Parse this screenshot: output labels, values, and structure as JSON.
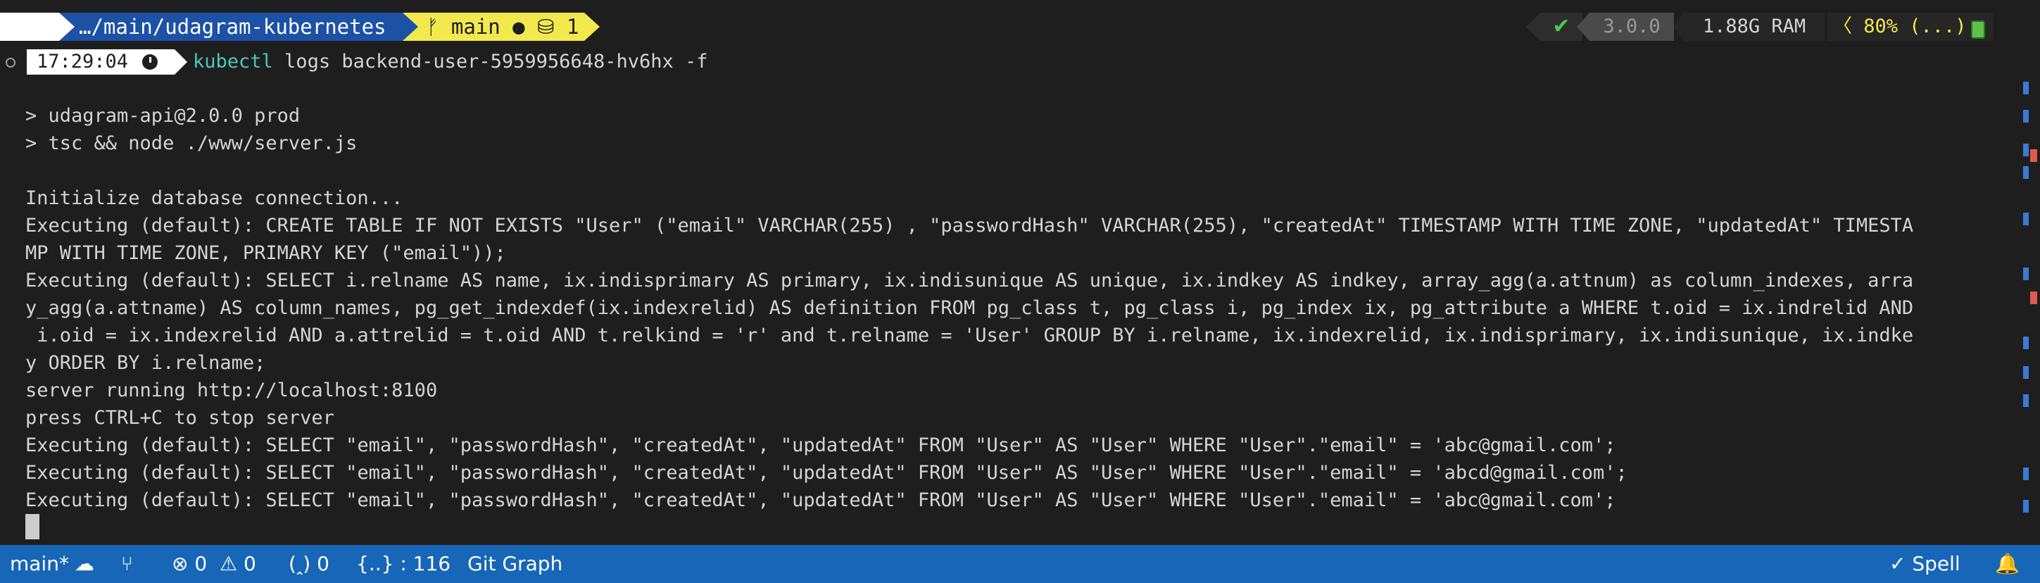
{
  "prompt": {
    "apple_glyph": "",
    "path": "…/main/udagram-kubernetes",
    "branch": "ᚠ main ● ⛁ 1",
    "check": "✔",
    "version": "3.0.0",
    "ram": "1.88G RAM",
    "battery": "80% (...)"
  },
  "row2": {
    "time": "17:29:04",
    "cmd_kw": "kubectl",
    "cmd_rest": " logs backend-user-5959956648-hv6hx -f"
  },
  "output": {
    "lines": [
      "> udagram-api@2.0.0 prod",
      "> tsc && node ./www/server.js",
      "",
      "Initialize database connection...",
      "Executing (default): CREATE TABLE IF NOT EXISTS \"User\" (\"email\" VARCHAR(255) , \"passwordHash\" VARCHAR(255), \"createdAt\" TIMESTAMP WITH TIME ZONE, \"updatedAt\" TIMESTA",
      "MP WITH TIME ZONE, PRIMARY KEY (\"email\"));",
      "Executing (default): SELECT i.relname AS name, ix.indisprimary AS primary, ix.indisunique AS unique, ix.indkey AS indkey, array_agg(a.attnum) as column_indexes, arra",
      "y_agg(a.attname) AS column_names, pg_get_indexdef(ix.indexrelid) AS definition FROM pg_class t, pg_class i, pg_index ix, pg_attribute a WHERE t.oid = ix.indrelid AND",
      " i.oid = ix.indexrelid AND a.attrelid = t.oid AND t.relkind = 'r' and t.relname = 'User' GROUP BY i.relname, ix.indexrelid, ix.indisprimary, ix.indisunique, ix.indke",
      "y ORDER BY i.relname;",
      "server running http://localhost:8100",
      "press CTRL+C to stop server",
      "Executing (default): SELECT \"email\", \"passwordHash\", \"createdAt\", \"updatedAt\" FROM \"User\" AS \"User\" WHERE \"User\".\"email\" = 'abc@gmail.com';",
      "Executing (default): SELECT \"email\", \"passwordHash\", \"createdAt\", \"updatedAt\" FROM \"User\" AS \"User\" WHERE \"User\".\"email\" = 'abcd@gmail.com';",
      "Executing (default): SELECT \"email\", \"passwordHash\", \"createdAt\", \"updatedAt\" FROM \"User\" AS \"User\" WHERE \"User\".\"email\" = 'abc@gmail.com';"
    ]
  },
  "statusbar": {
    "branch": "main*",
    "sync_icon": "☁",
    "source_control_icon": "⑂",
    "errors": "⊗ 0",
    "warnings": "⚠ 0",
    "ports": "(ꞈ) 0",
    "json_items": "{..} : 116",
    "git_graph": "Git Graph",
    "spell": "✓ Spell",
    "bell_icon": "🔔"
  },
  "colors": {
    "terminal_bg": "#1e1e1e",
    "status_bg": "#1766b8",
    "path_bg": "#1c51a6",
    "branch_bg": "#f2e94e",
    "command_color": "#4ec9b0"
  }
}
